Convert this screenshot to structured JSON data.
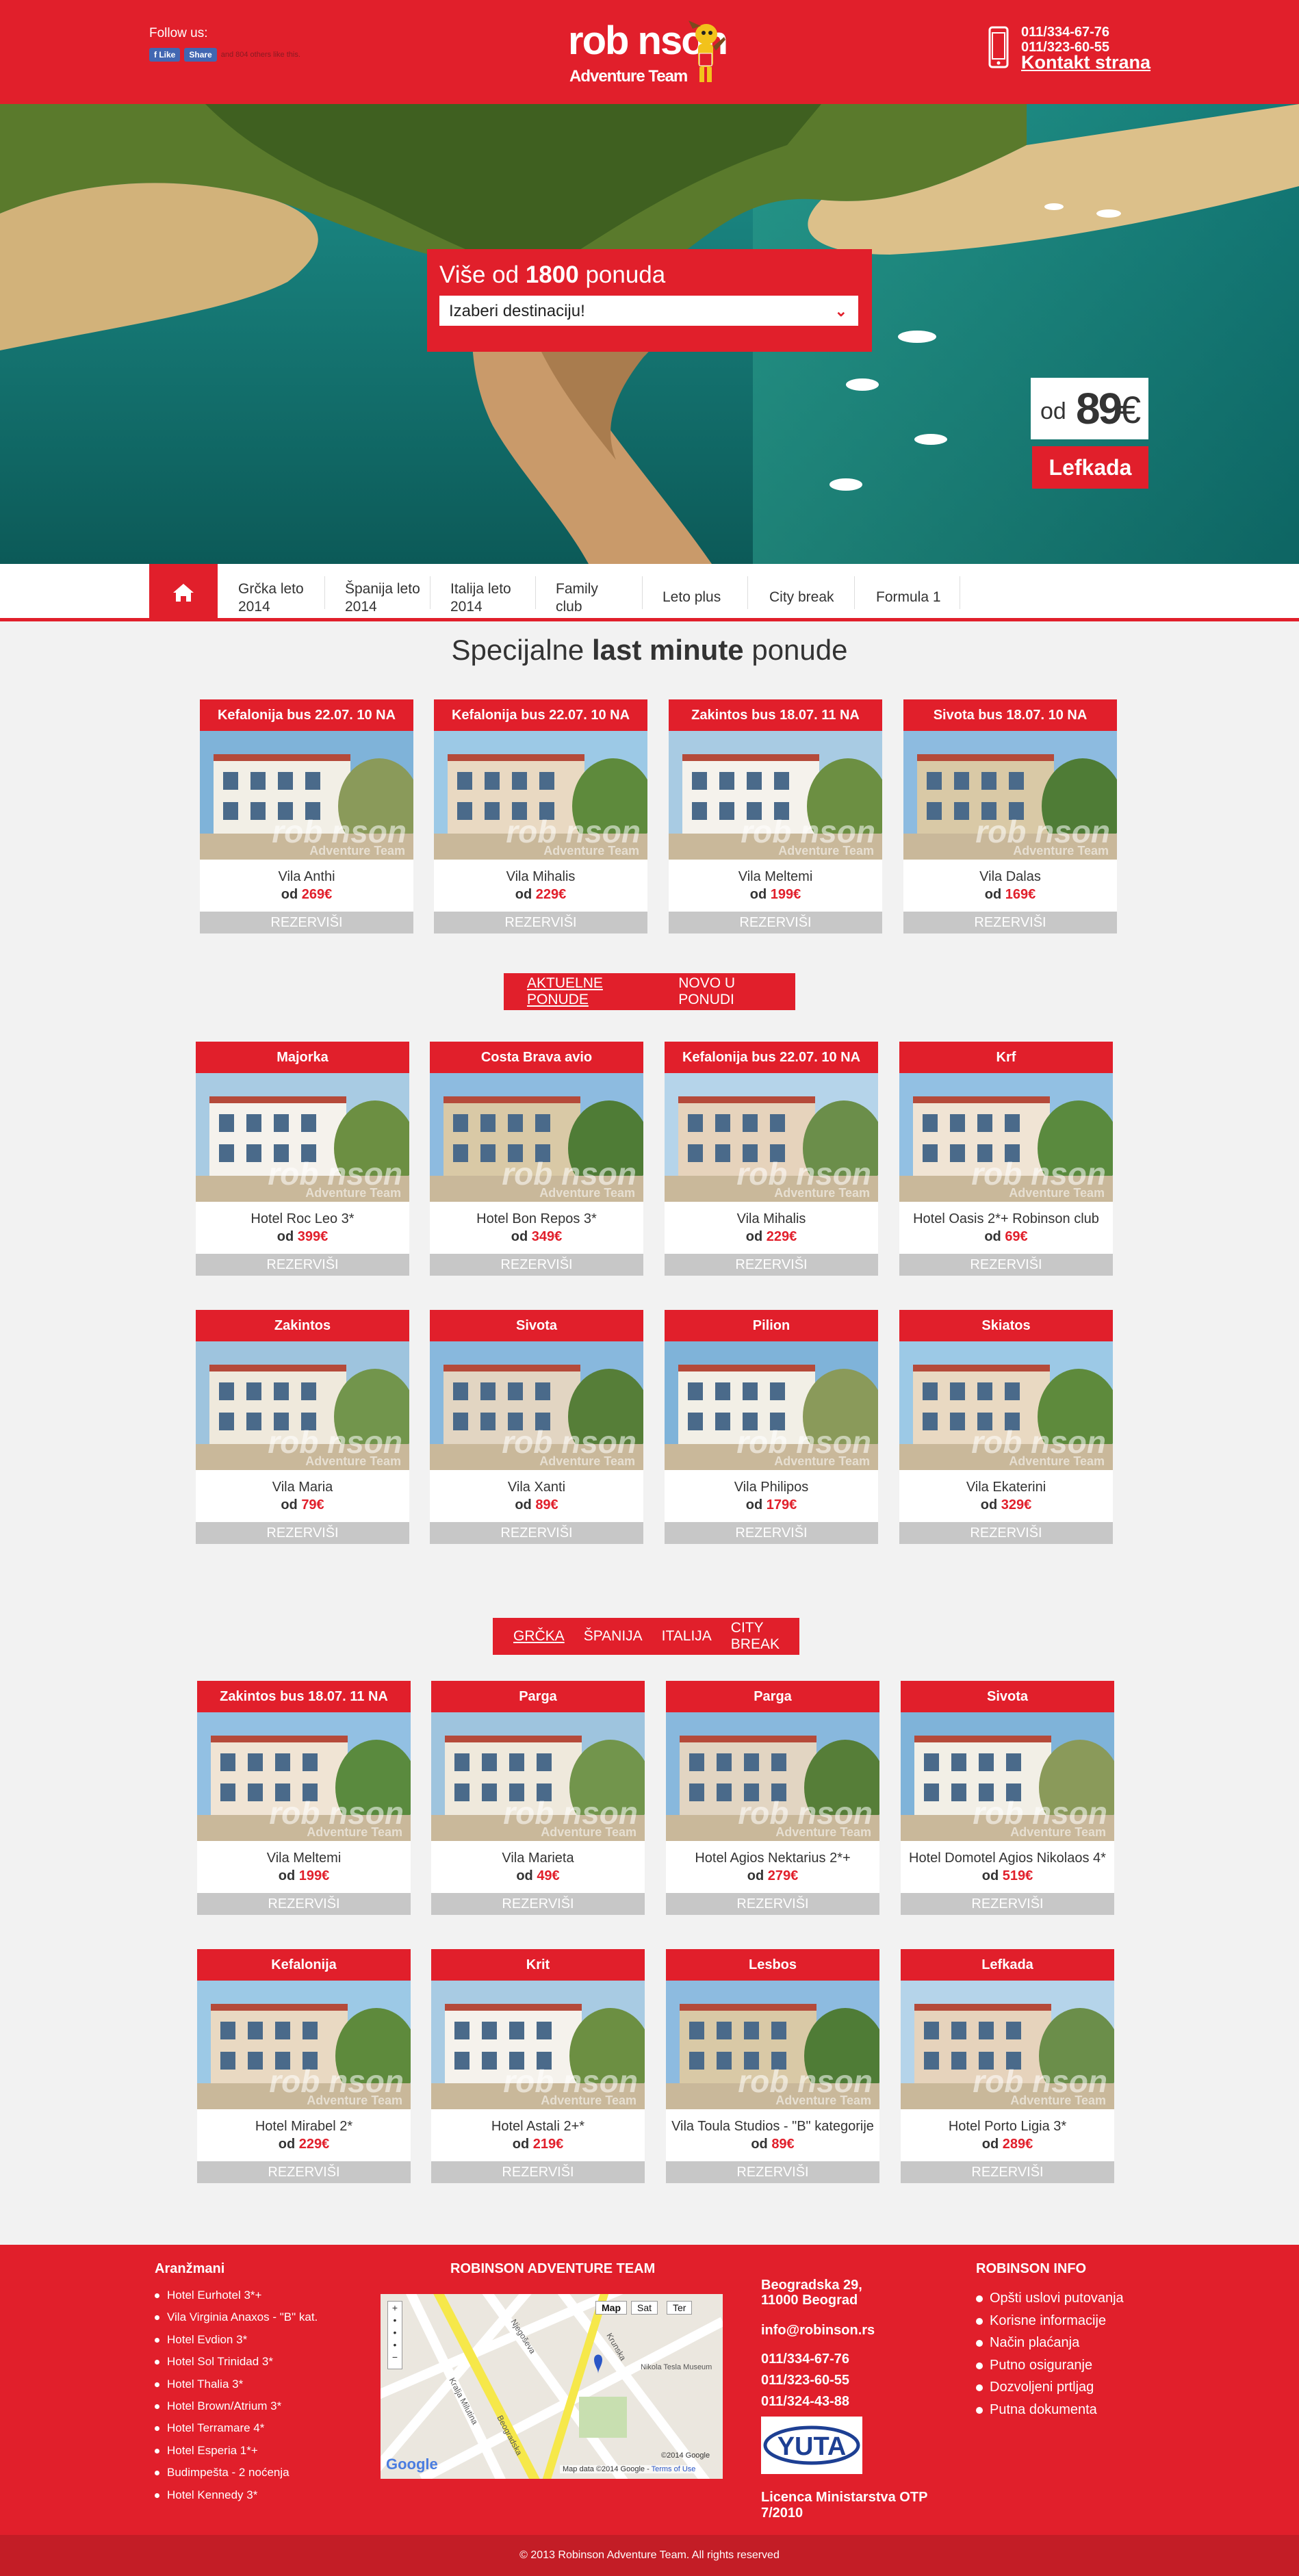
{
  "header": {
    "follow_label": "Follow us:",
    "fb_like": "Like",
    "fb_share": "Share",
    "fb_text": "and 804 others like this.",
    "logo_line1": "rob nson",
    "logo_line2": "Adventure Team",
    "phone1": "011/334-67-76",
    "phone2": "011/323-60-55",
    "contact_link": "Kontakt strana"
  },
  "hero": {
    "search_title_prefix": "Više od ",
    "search_title_count": "1800",
    "search_title_suffix": " ponuda",
    "select_placeholder": "Izaberi destinaciju!",
    "price_od": "od",
    "price_value": "89",
    "price_currency": "€",
    "destination": "Lefkada"
  },
  "nav": {
    "items": [
      "Grčka leto 2014",
      "Španija leto 2014",
      "Italija leto 2014",
      "Family club",
      "Leto plus",
      "City break",
      "Formula 1"
    ]
  },
  "last_minute": {
    "title_prefix": "Specijalne ",
    "title_bold": "last minute",
    "title_suffix": " ponude",
    "cards": [
      {
        "title": "Kefalonija bus 22.07. 10 NA",
        "name": "Vila Anthi",
        "price_prefix": "od ",
        "price": "269€",
        "button": "REZERVIŠI"
      },
      {
        "title": "Kefalonija bus 22.07. 10 NA",
        "name": "Vila Mihalis",
        "price_prefix": "od ",
        "price": "229€",
        "button": "REZERVIŠI"
      },
      {
        "title": "Zakintos bus 18.07. 11 NA",
        "name": "Vila Meltemi",
        "price_prefix": "od ",
        "price": "199€",
        "button": "REZERVIŠI"
      },
      {
        "title": "Sivota bus 18.07. 10 NA",
        "name": "Vila Dalas",
        "price_prefix": "od ",
        "price": "169€",
        "button": "REZERVIŠI"
      }
    ]
  },
  "offers_tabs": {
    "tab1": "AKTUELNE PONUDE",
    "tab2": "NOVO U PONUDI"
  },
  "offers": {
    "cards": [
      {
        "title": "Majorka",
        "name": "Hotel Roc Leo 3*",
        "price_prefix": "od ",
        "price": "399€",
        "button": "REZERVIŠI"
      },
      {
        "title": "Costa Brava avio",
        "name": "Hotel Bon Repos 3*",
        "price_prefix": "od ",
        "price": "349€",
        "button": "REZERVIŠI"
      },
      {
        "title": "Kefalonija bus 22.07. 10 NA",
        "name": "Vila Mihalis",
        "price_prefix": "od ",
        "price": "229€",
        "button": "REZERVIŠI"
      },
      {
        "title": "Krf",
        "name": "Hotel Oasis 2*+ Robinson club",
        "price_prefix": "od ",
        "price": "69€",
        "button": "REZERVIŠI"
      },
      {
        "title": "Zakintos",
        "name": "Vila Maria",
        "price_prefix": "od ",
        "price": "79€",
        "button": "REZERVIŠI"
      },
      {
        "title": "Sivota",
        "name": "Vila Xanti",
        "price_prefix": "od ",
        "price": "89€",
        "button": "REZERVIŠI"
      },
      {
        "title": "Pilion",
        "name": "Vila Philipos",
        "price_prefix": "od ",
        "price": "179€",
        "button": "REZERVIŠI"
      },
      {
        "title": "Skiatos",
        "name": "Vila Ekaterini",
        "price_prefix": "od ",
        "price": "329€",
        "button": "REZERVIŠI"
      }
    ]
  },
  "country_tabs": {
    "tabs": [
      "GRČKA",
      "ŠPANIJA",
      "ITALIJA",
      "CITY BREAK"
    ]
  },
  "country_offers": {
    "cards": [
      {
        "title": "Zakintos bus 18.07. 11 NA",
        "name": "Vila Meltemi",
        "price_prefix": "od ",
        "price": "199€",
        "button": "REZERVIŠI"
      },
      {
        "title": "Parga",
        "name": "Vila Marieta",
        "price_prefix": "od ",
        "price": "49€",
        "button": "REZERVIŠI"
      },
      {
        "title": "Parga",
        "name": "Hotel Agios Nektarius 2*+",
        "price_prefix": "od ",
        "price": "279€",
        "button": "REZERVIŠI"
      },
      {
        "title": "Sivota",
        "name": "Hotel Domotel Agios Nikolaos 4*",
        "price_prefix": "od ",
        "price": "519€",
        "button": "REZERVIŠI"
      },
      {
        "title": "Kefalonija",
        "name": "Hotel Mirabel 2*",
        "price_prefix": "od ",
        "price": "229€",
        "button": "REZERVIŠI"
      },
      {
        "title": "Krit",
        "name": "Hotel Astali 2+*",
        "price_prefix": "od ",
        "price": "219€",
        "button": "REZERVIŠI"
      },
      {
        "title": "Lesbos",
        "name": "Vila Toula Studios - \"B\" kategorije",
        "price_prefix": "od ",
        "price": "89€",
        "button": "REZERVIŠI"
      },
      {
        "title": "Lefkada",
        "name": "Hotel Porto Ligia 3*",
        "price_prefix": "od ",
        "price": "289€",
        "button": "REZERVIŠI"
      }
    ]
  },
  "footer": {
    "col1_title": "Aranžmani",
    "col1_items": [
      "Hotel Eurhotel 3*+",
      "Vila Virginia Anaxos - \"B\" kat.",
      "Hotel Evdion 3*",
      "Hotel Sol Trinidad 3*",
      "Hotel Thalia 3*",
      "Hotel Brown/Atrium 3*",
      "Hotel Terramare 4*",
      "Hotel Esperia 1*+",
      "Budimpešta - 2 noćenja",
      "Hotel Kennedy 3*"
    ],
    "col2_title": "ROBINSON ADVENTURE TEAM",
    "map_tabs": [
      "Map",
      "Sat",
      "Ter"
    ],
    "map_streets": [
      "Kralja Milutina",
      "Beogradska",
      "Njegoševa",
      "Krunska"
    ],
    "map_poi": "Nikola Tesla Museum",
    "map_credit": "Map data ©2014 Google",
    "map_terms": "Terms of Use",
    "map_copy": "©2014 Google",
    "google": "Google",
    "address1": "Beogradska 29,",
    "address2": "11000 Beograd",
    "email": "info@robinson.rs",
    "phones": [
      "011/334-67-76",
      "011/323-60-55",
      "011/324-43-88"
    ],
    "yuta": "YUTA",
    "license": "Licenca Ministarstva OTP 7/2010",
    "col4_title": "ROBINSON INFO",
    "col4_items": [
      "Opšti uslovi putovanja",
      "Korisne informacije",
      "Način plaćanja",
      "Putno osiguranje",
      "Dozvoljeni prtljag",
      "Putna dokumenta"
    ],
    "copyright": "© 2013 Robinson Adventure Team. All rights reserved"
  },
  "colors": {
    "brand_red": "#e11f2b",
    "button_gray": "#c7c7c7",
    "background": "#f2f2f2"
  }
}
